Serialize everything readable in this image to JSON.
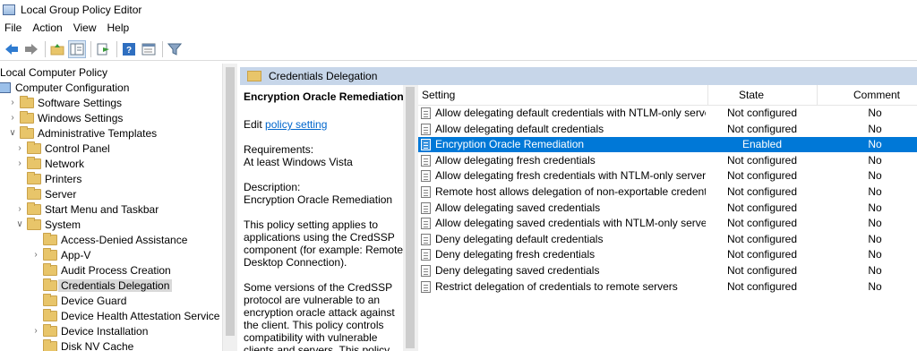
{
  "window": {
    "title": "Local Group Policy Editor"
  },
  "menu": {
    "items": [
      "File",
      "Action",
      "View",
      "Help"
    ]
  },
  "toolbar": {
    "icons": [
      "back-arrow-icon",
      "forward-arrow-icon",
      "up-folder-icon",
      "show-hide-tree-icon",
      "export-list-icon",
      "help-icon",
      "properties-icon",
      "filter-icon"
    ]
  },
  "tree": {
    "items": [
      {
        "label": "Local Computer Policy",
        "icon": "computer-icon",
        "twisty": ""
      },
      {
        "label": "Computer Configuration",
        "icon": "computer-icon",
        "twisty": "∨"
      },
      {
        "label": "Software Settings",
        "icon": "folder-icon",
        "twisty": "›"
      },
      {
        "label": "Windows Settings",
        "icon": "folder-icon",
        "twisty": "›"
      },
      {
        "label": "Administrative Templates",
        "icon": "folder-icon",
        "twisty": "∨"
      },
      {
        "label": "Control Panel",
        "icon": "folder-icon",
        "twisty": "›"
      },
      {
        "label": "Network",
        "icon": "folder-icon",
        "twisty": "›"
      },
      {
        "label": "Printers",
        "icon": "folder-icon",
        "twisty": ""
      },
      {
        "label": "Server",
        "icon": "folder-icon",
        "twisty": ""
      },
      {
        "label": "Start Menu and Taskbar",
        "icon": "folder-icon",
        "twisty": "›"
      },
      {
        "label": "System",
        "icon": "folder-icon",
        "twisty": "∨"
      },
      {
        "label": "Access-Denied Assistance",
        "icon": "folder-icon",
        "twisty": ""
      },
      {
        "label": "App-V",
        "icon": "folder-icon",
        "twisty": "›"
      },
      {
        "label": "Audit Process Creation",
        "icon": "folder-icon",
        "twisty": ""
      },
      {
        "label": "Credentials Delegation",
        "icon": "folder-icon",
        "twisty": "",
        "selected": true
      },
      {
        "label": "Device Guard",
        "icon": "folder-icon",
        "twisty": ""
      },
      {
        "label": "Device Health Attestation Service",
        "icon": "folder-icon",
        "twisty": ""
      },
      {
        "label": "Device Installation",
        "icon": "folder-icon",
        "twisty": "›"
      },
      {
        "label": "Disk NV Cache",
        "icon": "folder-icon",
        "twisty": ""
      }
    ]
  },
  "right_header": {
    "title": "Credentials Delegation"
  },
  "description": {
    "title": "Encryption Oracle Remediation",
    "edit_prefix": "Edit",
    "edit_link": "policy setting",
    "requirements_label": "Requirements:",
    "requirements_value": "At least Windows Vista",
    "description_label": "Description:",
    "description_value": "Encryption Oracle Remediation",
    "para1": "This policy setting applies to applications using the CredSSP component (for example: Remote Desktop Connection).",
    "para2": "Some versions of the CredSSP protocol are vulnerable to an encryption oracle attack against the client.  This policy controls compatibility with vulnerable clients and servers.  This policy"
  },
  "list": {
    "columns": {
      "setting": "Setting",
      "state": "State",
      "comment": "Comment"
    },
    "rows": [
      {
        "setting": "Allow delegating default credentials with NTLM-only server ...",
        "state": "Not configured",
        "comment": "No"
      },
      {
        "setting": "Allow delegating default credentials",
        "state": "Not configured",
        "comment": "No"
      },
      {
        "setting": "Encryption Oracle Remediation",
        "state": "Enabled",
        "comment": "No",
        "selected": true
      },
      {
        "setting": "Allow delegating fresh credentials",
        "state": "Not configured",
        "comment": "No"
      },
      {
        "setting": "Allow delegating fresh credentials with NTLM-only server a...",
        "state": "Not configured",
        "comment": "No"
      },
      {
        "setting": "Remote host allows delegation of non-exportable credentials",
        "state": "Not configured",
        "comment": "No"
      },
      {
        "setting": "Allow delegating saved credentials",
        "state": "Not configured",
        "comment": "No"
      },
      {
        "setting": "Allow delegating saved credentials with NTLM-only server a...",
        "state": "Not configured",
        "comment": "No"
      },
      {
        "setting": "Deny delegating default credentials",
        "state": "Not configured",
        "comment": "No"
      },
      {
        "setting": "Deny delegating fresh credentials",
        "state": "Not configured",
        "comment": "No"
      },
      {
        "setting": "Deny delegating saved credentials",
        "state": "Not configured",
        "comment": "No"
      },
      {
        "setting": "Restrict delegation of credentials to remote servers",
        "state": "Not configured",
        "comment": "No"
      }
    ]
  },
  "colors": {
    "selection": "#0078d7",
    "header_band": "#c7d6e9",
    "link": "#0066cc"
  }
}
